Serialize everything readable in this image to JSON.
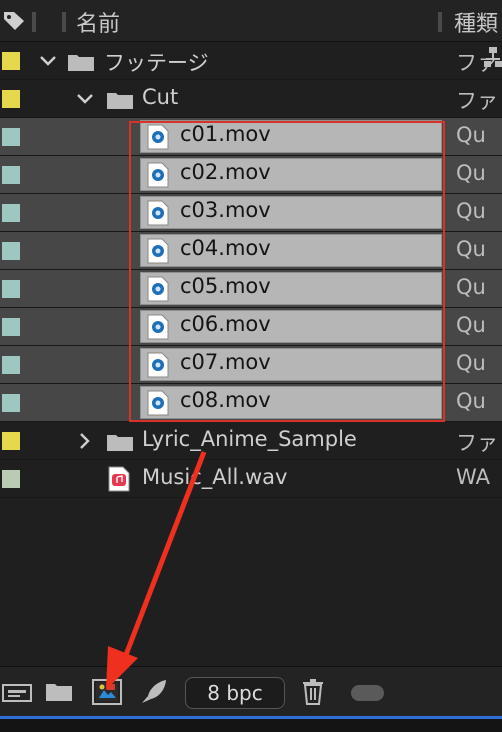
{
  "header": {
    "name_col": "名前",
    "type_col": "種類"
  },
  "colors": {
    "folder_label": "#e5d84c",
    "video_label": "#9fc7c2",
    "audio_label": "#b9cbb2",
    "selection_outline": "#d8332a",
    "annotation_arrow": "#f0301f"
  },
  "tree": {
    "footage_folder": {
      "name": "フッテージ",
      "type": "ファ",
      "label_color": "#e5d84c",
      "expanded": true
    },
    "cut_folder": {
      "name": "Cut",
      "type": "ファ",
      "label_color": "#e5d84c",
      "expanded": true
    },
    "files": [
      {
        "name": "c01.mov",
        "type": "Qu",
        "icon": "quicktime-file-icon"
      },
      {
        "name": "c02.mov",
        "type": "Qu",
        "icon": "quicktime-file-icon"
      },
      {
        "name": "c03.mov",
        "type": "Qu",
        "icon": "quicktime-file-icon"
      },
      {
        "name": "c04.mov",
        "type": "Qu",
        "icon": "quicktime-file-icon"
      },
      {
        "name": "c05.mov",
        "type": "Qu",
        "icon": "quicktime-file-icon"
      },
      {
        "name": "c06.mov",
        "type": "Qu",
        "icon": "quicktime-file-icon"
      },
      {
        "name": "c07.mov",
        "type": "Qu",
        "icon": "quicktime-file-icon"
      },
      {
        "name": "c08.mov",
        "type": "Qu",
        "icon": "quicktime-file-icon"
      }
    ],
    "lyric_folder": {
      "name": "Lyric_Anime_Sample",
      "type": "ファ",
      "label_color": "#e5d84c",
      "expanded": false
    },
    "music_file": {
      "name": "Music_All.wav",
      "type": "WA",
      "icon": "audio-file-icon"
    }
  },
  "bottom_bar": {
    "icons": [
      "interpret-footage-icon",
      "new-folder-icon",
      "new-composition-icon",
      "render-queue-icon",
      "trash-icon",
      "toggle-icon"
    ],
    "bit_depth": "8 bpc"
  }
}
